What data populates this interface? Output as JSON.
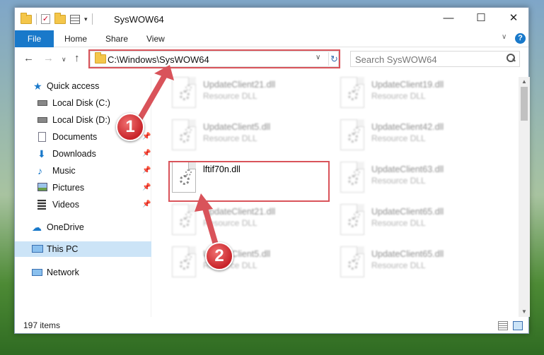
{
  "window": {
    "title": "SysWOW64",
    "controls": {
      "minimize": "—",
      "maximize": "☐",
      "close": "✕"
    }
  },
  "ribbon": {
    "file_tab": "File",
    "tabs": [
      "Home",
      "Share",
      "View"
    ]
  },
  "navigation": {
    "address": "C:\\Windows\\SysWOW64",
    "search_placeholder": "Search SysWOW64"
  },
  "sidebar": {
    "items": [
      {
        "label": "Quick access",
        "icon": "star-icon"
      },
      {
        "label": "Local Disk (C:)",
        "icon": "drive-icon"
      },
      {
        "label": "Local Disk (D:)",
        "icon": "drive-icon"
      },
      {
        "label": "Documents",
        "icon": "documents-icon",
        "pinned": true
      },
      {
        "label": "Downloads",
        "icon": "downloads-icon",
        "pinned": true
      },
      {
        "label": "Music",
        "icon": "music-icon",
        "pinned": true
      },
      {
        "label": "Pictures",
        "icon": "pictures-icon",
        "pinned": true
      },
      {
        "label": "Videos",
        "icon": "videos-icon",
        "pinned": true
      },
      {
        "label": "OneDrive",
        "icon": "cloud-icon"
      },
      {
        "label": "This PC",
        "icon": "monitor-icon",
        "selected": true
      },
      {
        "label": "Network",
        "icon": "network-icon"
      }
    ]
  },
  "files": [
    {
      "name": "UpdateClient21.dll",
      "type": "Resource DLL",
      "blurred": true
    },
    {
      "name": "UpdateClient19.dll",
      "type": "Resource DLL",
      "blurred": true
    },
    {
      "name": "UpdateClient5.dll",
      "type": "Resource DLL",
      "blurred": true
    },
    {
      "name": "UpdateClient42.dll",
      "type": "Resource DLL",
      "blurred": true
    },
    {
      "name": "lftif70n.dll",
      "type": "",
      "blurred": false,
      "highlighted": true
    },
    {
      "name": "UpdateClient63.dll",
      "type": "Resource DLL",
      "blurred": true
    },
    {
      "name": "UpdateClient21.dll",
      "type": "Resource DLL",
      "blurred": true
    },
    {
      "name": "UpdateClient65.dll",
      "type": "Resource DLL",
      "blurred": true
    },
    {
      "name": "UpdateClient5.dll",
      "type": "Resource DLL",
      "blurred": true
    },
    {
      "name": "UpdateClient65.dll",
      "type": "Resource DLL",
      "blurred": true
    }
  ],
  "status": {
    "item_count": "197 items"
  },
  "annotations": {
    "step1": "1",
    "step2": "2",
    "color": "#d9535a"
  }
}
